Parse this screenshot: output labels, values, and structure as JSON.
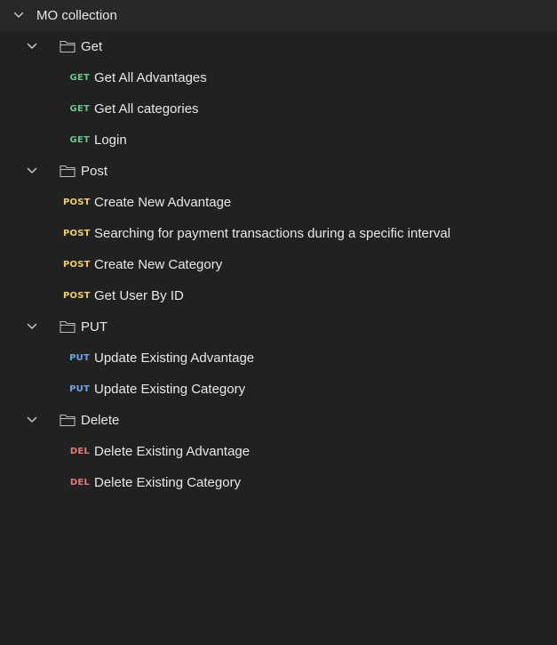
{
  "collection": {
    "name": "MO collection",
    "expanded": true
  },
  "folders": [
    {
      "name": "Get",
      "requests": [
        {
          "method": "GET",
          "name": "Get All Advantages"
        },
        {
          "method": "GET",
          "name": "Get All categories"
        },
        {
          "method": "GET",
          "name": "Login"
        }
      ]
    },
    {
      "name": "Post",
      "requests": [
        {
          "method": "POST",
          "name": "Create New Advantage"
        },
        {
          "method": "POST",
          "name": "Searching for payment transactions during a specific interval"
        },
        {
          "method": "POST",
          "name": "Create New Category"
        },
        {
          "method": "POST",
          "name": "Get User By ID"
        }
      ]
    },
    {
      "name": "PUT",
      "requests": [
        {
          "method": "PUT",
          "name": "Update Existing Advantage"
        },
        {
          "method": "PUT",
          "name": "Update Existing Category"
        }
      ]
    },
    {
      "name": "Delete",
      "requests": [
        {
          "method": "DEL",
          "name": "Delete Existing Advantage"
        },
        {
          "method": "DEL",
          "name": "Delete Existing Category"
        }
      ]
    }
  ],
  "colors": {
    "background": "#212121",
    "collection_row": "#282828",
    "get": "#6bc48a",
    "post": "#f2cd6a",
    "put": "#6ea3e6",
    "del": "#e07b78"
  },
  "icons": {
    "chevron": "chevron-down-icon",
    "folder": "folder-icon"
  }
}
